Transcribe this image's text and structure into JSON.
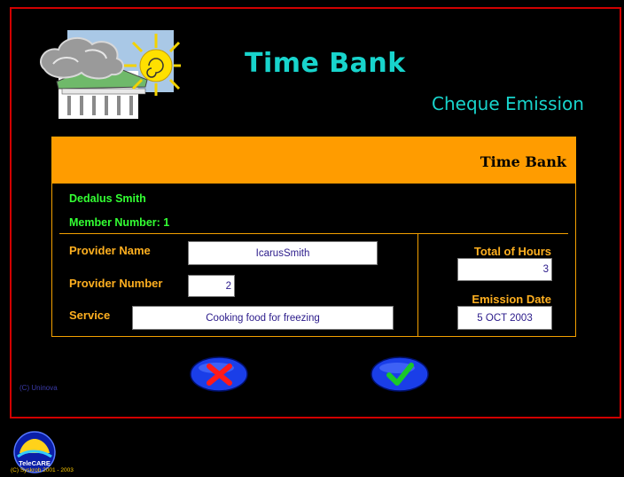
{
  "header": {
    "title": "Time Bank",
    "subtitle": "Cheque Emission"
  },
  "panel": {
    "title": "Time Bank",
    "member_name": "Dedalus Smith",
    "member_number": "Member Number: 1"
  },
  "form": {
    "provider_name_label": "Provider Name",
    "provider_name_value": "IcarusSmith",
    "provider_number_label": "Provider Number",
    "provider_number_value": "2",
    "service_label": "Service",
    "service_value": "Cooking food for freezing",
    "total_hours_label": "Total of Hours",
    "total_hours_value": "3",
    "emission_date_label": "Emission Date",
    "emission_date_value": "5 OCT 2003"
  },
  "actions": {
    "cancel_icon": "cross-icon",
    "confirm_icon": "check-icon"
  },
  "footer": {
    "copyright": "(C) Uninova",
    "brand": "TeleCARE",
    "brand_copyright": "(C) Syskrob 2001 - 2003"
  },
  "colors": {
    "accent": "#ff9c00",
    "title": "#18d4cc",
    "member_text": "#33ff33",
    "frame": "#d10000"
  }
}
